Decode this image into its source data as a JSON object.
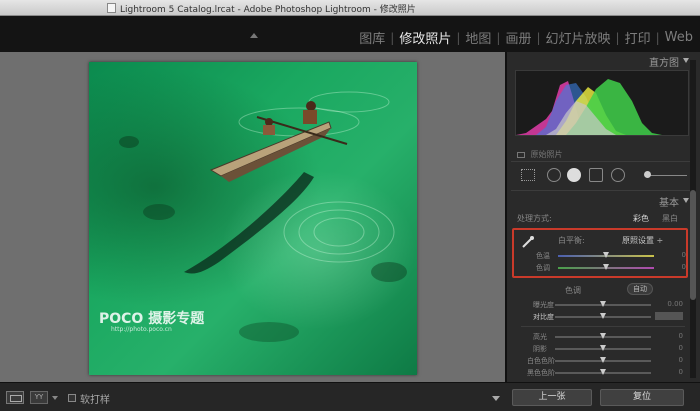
{
  "window": {
    "title": "Lightroom 5 Catalog.lrcat - Adobe Photoshop Lightroom - 修改照片"
  },
  "modules": [
    {
      "label": "图库",
      "active": false
    },
    {
      "label": "修改照片",
      "active": true
    },
    {
      "label": "地图",
      "active": false
    },
    {
      "label": "画册",
      "active": false
    },
    {
      "label": "幻灯片放映",
      "active": false
    },
    {
      "label": "打印",
      "active": false
    },
    {
      "label": "Web",
      "active": false
    }
  ],
  "photo": {
    "watermark": "POCO 摄影专题",
    "watermark_url": "http://photo.poco.cn"
  },
  "histogram": {
    "title": "直方图",
    "original_photo_label": "原始照片"
  },
  "basic": {
    "title": "基本",
    "treatment_label": "处理方式:",
    "treatment_color": "彩色",
    "treatment_bw": "黑白",
    "white_balance": {
      "label": "白平衡:",
      "value": "原照设置 ÷",
      "sliders": [
        {
          "label": "色温",
          "value": "0",
          "position": 0.5
        },
        {
          "label": "色调",
          "value": "0",
          "position": 0.5
        }
      ]
    },
    "tone": {
      "label": "色调",
      "auto_label": "自动",
      "sliders": [
        {
          "label": "曝光度",
          "value": "0.00",
          "position": 0.5
        },
        {
          "label": "对比度",
          "value": "",
          "position": 0.5
        },
        {
          "label": "高光",
          "value": "0",
          "position": 0.5
        },
        {
          "label": "阴影",
          "value": "0",
          "position": 0.5
        },
        {
          "label": "白色色阶",
          "value": "0",
          "position": 0.5
        },
        {
          "label": "黑色色阶",
          "value": "0",
          "position": 0.5
        }
      ]
    }
  },
  "colors": {
    "accent_highlight": "#c93a2a",
    "temp_track": "#4b5fb0",
    "tint_track": "#8a4fa0"
  },
  "bottom_bar": {
    "view_mode_icon": "loupe-view-icon",
    "compare_label": "YY",
    "soft_proof_label": "软打样",
    "previous_label": "上一张",
    "reset_label": "复位"
  }
}
